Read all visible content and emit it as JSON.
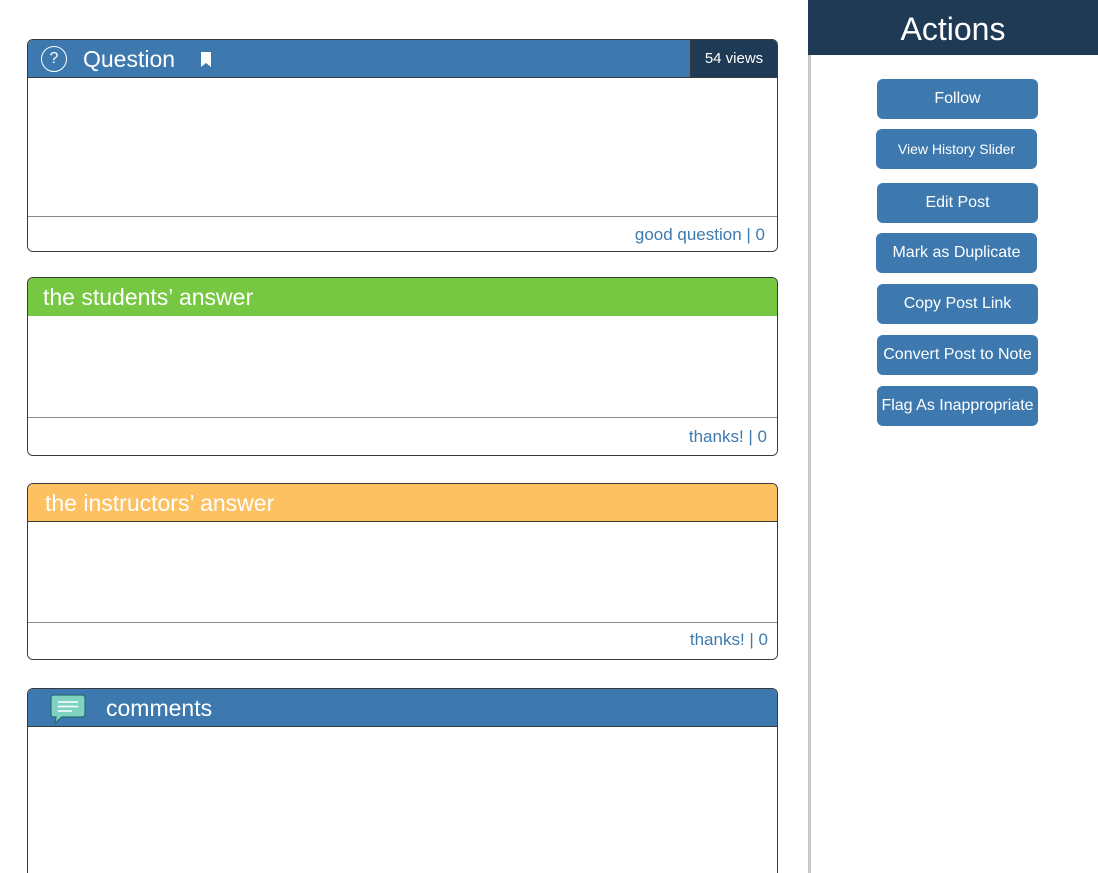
{
  "question": {
    "icon_glyph": "?",
    "title": "Question",
    "views": "54 views",
    "vote_label": "good question | 0"
  },
  "students_answer": {
    "title": "the students’ answer",
    "vote_label": "thanks! | 0"
  },
  "instructors_answer": {
    "title": "the instructors’ answer",
    "vote_label": "thanks! | 0"
  },
  "comments": {
    "title": "comments"
  },
  "actions": {
    "title": "Actions",
    "buttons": [
      "Follow",
      "View History Slider",
      "Edit Post",
      "Mark as Duplicate",
      "Copy Post Link",
      "Convert Post to Note",
      "Flag As Inappropriate"
    ]
  },
  "colors": {
    "question_header": "#3d79ae",
    "students_header": "#76c843",
    "instructors_header": "#fec162",
    "dark_navy": "#1e3a55",
    "vote_link": "#3d7ab0",
    "comment_icon": "#7fd3c0"
  },
  "icons": {
    "question": "help-circle-icon",
    "bookmark": "bookmark-icon",
    "comments": "chat-bubble-icon"
  }
}
